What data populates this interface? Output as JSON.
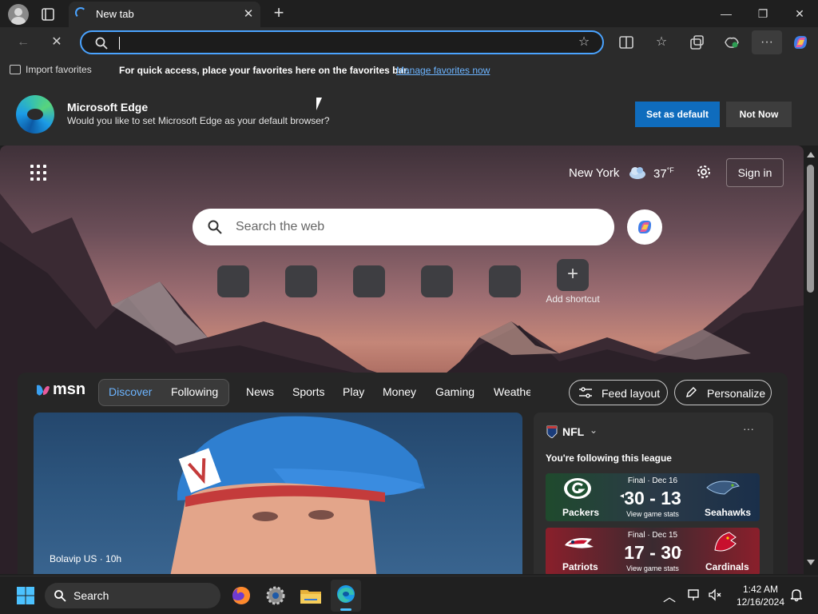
{
  "browser": {
    "tab_title": "New tab",
    "address_value": "",
    "favorites_bar": {
      "import_label": "Import favorites",
      "message": "For quick access, place your favorites here on the favorites bar.",
      "link": "Manage favorites now"
    },
    "default_prompt": {
      "title": "Microsoft Edge",
      "subtitle": "Would you like to set Microsoft Edge as your default browser?",
      "set_default": "Set as default",
      "not_now": "Not Now"
    }
  },
  "newtab": {
    "weather": {
      "city": "New York",
      "temp": "37",
      "unit": "°F"
    },
    "sign_in": "Sign in",
    "search_placeholder": "Search the web",
    "add_shortcut": "Add shortcut"
  },
  "feed": {
    "brand": "msn",
    "segments": [
      "Discover",
      "Following"
    ],
    "nav": [
      "News",
      "Sports",
      "Play",
      "Money",
      "Gaming",
      "Weathe"
    ],
    "feed_layout": "Feed layout",
    "personalize": "Personalize",
    "hero_source": "Bolavip US · 10h",
    "nfl": {
      "title": "NFL",
      "following": "You're following this league",
      "games": [
        {
          "status": "Final · Dec 16",
          "score": "30 - 13",
          "stats": "View game stats",
          "home": "Packers",
          "away": "Seahawks"
        },
        {
          "status": "Final · Dec 15",
          "score": "17 - 30",
          "stats": "View game stats",
          "home": "Patriots",
          "away": "Cardinals"
        }
      ]
    }
  },
  "taskbar": {
    "search_label": "Search",
    "time": "1:42 AM",
    "date": "12/16/2024"
  },
  "icons": [
    "profile-icon",
    "tab-actions-icon",
    "loading-spinner-icon",
    "back-arrow-icon",
    "stop-icon",
    "search-icon",
    "star-icon",
    "split-screen-icon",
    "favorites-icon",
    "collections-icon",
    "performance-icon",
    "more-icon",
    "copilot-icon",
    "apps-grid-icon",
    "cloud-icon",
    "gear-icon",
    "windows-start-icon",
    "firefox-icon",
    "settings-app-icon",
    "file-explorer-icon",
    "edge-icon",
    "chevron-up-icon",
    "network-icon",
    "notification-bell-icon"
  ],
  "colors": {
    "accent": "#4aa3ff",
    "primary_button": "#0f6cbd",
    "link": "#6cb4ff"
  }
}
